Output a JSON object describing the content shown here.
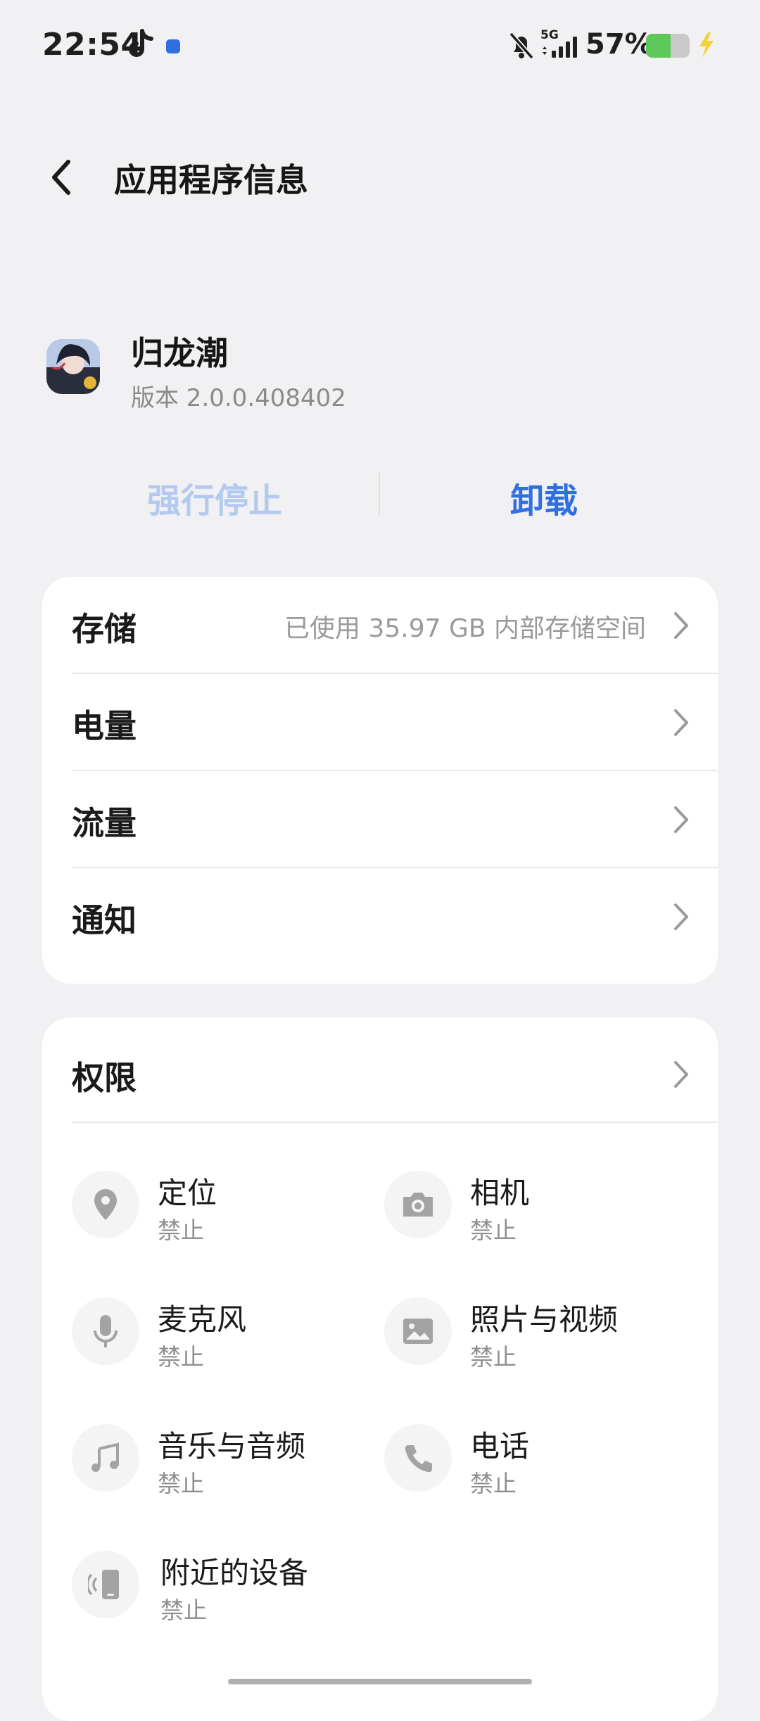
{
  "status_bar": {
    "time": "22:54",
    "network": "5G",
    "battery_percent": "57%",
    "battery_level": 0.57,
    "icons": [
      "tiktok-icon",
      "message-icon",
      "bell-muted-icon",
      "signal-icon",
      "battery-icon",
      "charging-bolt-icon"
    ]
  },
  "header": {
    "title": "应用程序信息",
    "back_icon": "chevron-left-icon"
  },
  "app": {
    "name": "归龙潮",
    "version": "版本 2.0.0.408402"
  },
  "actions": {
    "force_stop": "强行停止",
    "uninstall": "卸载",
    "force_stop_color": "#b3c9ef",
    "uninstall_color": "#2f6fe0"
  },
  "settings": [
    {
      "label": "存储",
      "value": "已使用 35.97 GB 内部存储空间"
    },
    {
      "label": "电量",
      "value": ""
    },
    {
      "label": "流量",
      "value": ""
    },
    {
      "label": "通知",
      "value": ""
    }
  ],
  "permissions": {
    "title": "权限",
    "items": [
      {
        "name": "定位",
        "status": "禁止",
        "icon": "location-icon"
      },
      {
        "name": "相机",
        "status": "禁止",
        "icon": "camera-icon"
      },
      {
        "name": "麦克风",
        "status": "禁止",
        "icon": "microphone-icon"
      },
      {
        "name": "照片与视频",
        "status": "禁止",
        "icon": "image-icon"
      },
      {
        "name": "音乐与音频",
        "status": "禁止",
        "icon": "music-icon"
      },
      {
        "name": "电话",
        "status": "禁止",
        "icon": "phone-icon"
      },
      {
        "name": "附近的设备",
        "status": "禁止",
        "icon": "nearby-devices-icon"
      }
    ]
  }
}
